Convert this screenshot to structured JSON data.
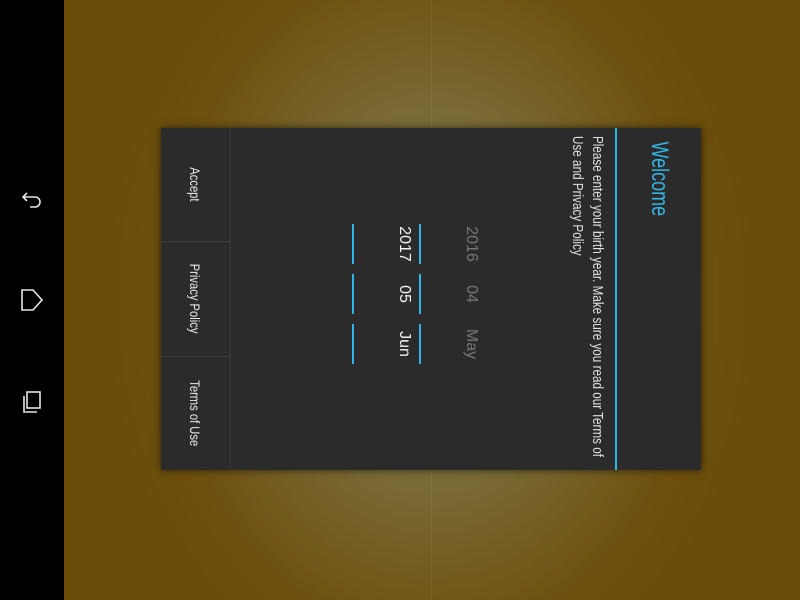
{
  "navigation": {
    "back_icon": "back-icon",
    "home_icon": "home-icon",
    "recents_icon": "recent-apps-icon"
  },
  "dialog": {
    "title": "Welcome",
    "message": "Please enter your birth year. Make sure you read our Terms of Use and Privacy Policy",
    "accent_color": "#33b5e5",
    "date_picker": {
      "month": {
        "previous": "May",
        "selected": "Jun"
      },
      "day": {
        "previous": "04",
        "selected": "05"
      },
      "year": {
        "previous": "2016",
        "selected": "2017"
      }
    },
    "buttons": {
      "terms": "Terms of Use",
      "privacy": "Privacy Policy",
      "accept": "Accept"
    }
  }
}
